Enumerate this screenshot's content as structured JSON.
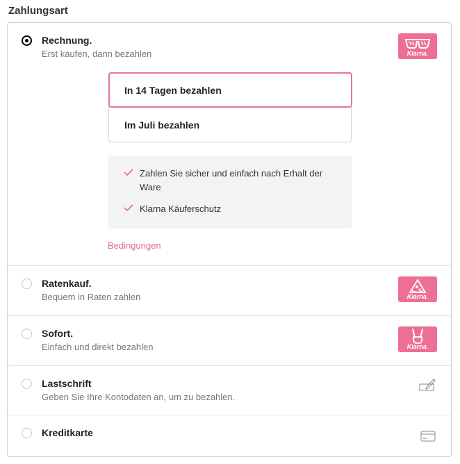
{
  "section": {
    "title": "Zahlungsart"
  },
  "brand": {
    "accent": "#ee6f94",
    "selection_border": "#e2759b",
    "link_color": "#e06a90"
  },
  "options": [
    {
      "title": "Rechnung.",
      "subtitle": "Erst kaufen, dann bezahlen",
      "selected": true,
      "badge_text": "Klarna.",
      "badge_icon": "sunglasses-icon",
      "plans": [
        "In 14 Tagen bezahlen",
        "Im Juli bezahlen"
      ],
      "selected_plan": "In 14 Tagen bezahlen",
      "benefits": [
        "Zahlen Sie sicher und einfach nach Erhalt der Ware",
        "Klarna Käuferschutz"
      ],
      "terms_link": "Bedingungen"
    },
    {
      "title": "Ratenkauf.",
      "subtitle": "Bequem in Raten zahlen",
      "selected": false,
      "badge_text": "Klarna.",
      "badge_icon": "pizza-slice-icon"
    },
    {
      "title": "Sofort.",
      "subtitle": "Einfach und direkt bezahlen",
      "selected": false,
      "badge_text": "Klarna.",
      "badge_icon": "peace-hand-icon"
    },
    {
      "title": "Lastschrift",
      "subtitle": "Geben Sie Ihre Kontodaten an, um zu bezahlen.",
      "selected": false,
      "icon": "direct-debit-icon"
    },
    {
      "title": "Kreditkarte",
      "selected": false,
      "icon": "credit-card-icon"
    }
  ]
}
